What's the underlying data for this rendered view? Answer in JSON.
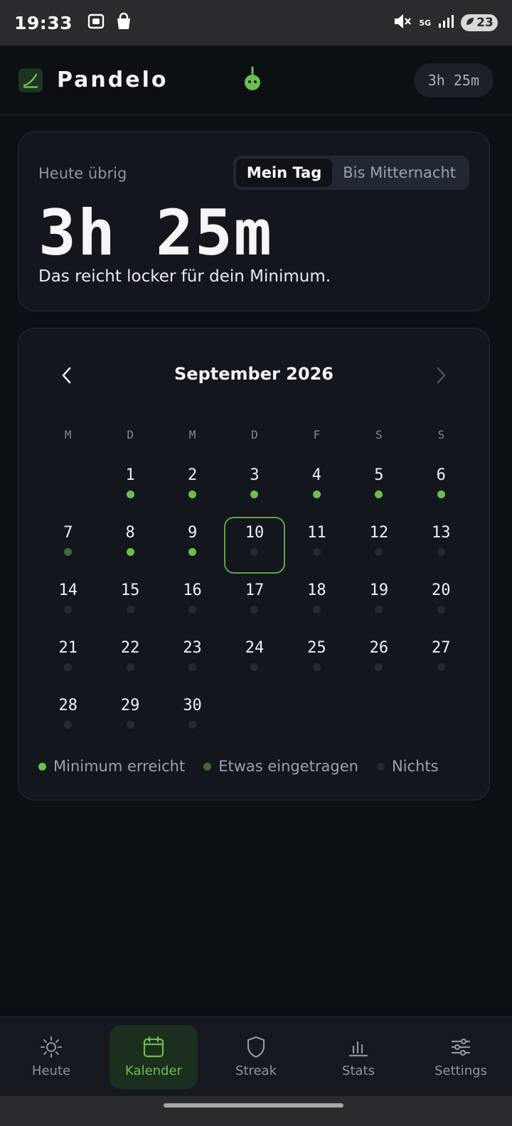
{
  "status_bar": {
    "time": "19:33",
    "network": "5G",
    "battery": "23"
  },
  "header": {
    "app_name": "Pandelo",
    "remaining_chip": "3h 25m"
  },
  "today": {
    "label": "Heute übrig",
    "toggle": {
      "option_1": "Mein Tag",
      "option_2": "Bis Mitternacht",
      "selected": "Mein Tag"
    },
    "remaining": "3h 25m",
    "message": "Das reicht locker für dein Minimum."
  },
  "calendar": {
    "month_title": "September 2026",
    "weekdays": [
      "M",
      "D",
      "M",
      "D",
      "F",
      "S",
      "S"
    ],
    "leading_blanks": 1,
    "selected_day": "10",
    "days": [
      {
        "n": "1",
        "s": "full"
      },
      {
        "n": "2",
        "s": "full"
      },
      {
        "n": "3",
        "s": "full"
      },
      {
        "n": "4",
        "s": "full"
      },
      {
        "n": "5",
        "s": "full"
      },
      {
        "n": "6",
        "s": "full"
      },
      {
        "n": "7",
        "s": "some"
      },
      {
        "n": "8",
        "s": "full"
      },
      {
        "n": "9",
        "s": "full"
      },
      {
        "n": "10",
        "s": "none"
      },
      {
        "n": "11",
        "s": "none"
      },
      {
        "n": "12",
        "s": "none"
      },
      {
        "n": "13",
        "s": "none"
      },
      {
        "n": "14",
        "s": "none"
      },
      {
        "n": "15",
        "s": "none"
      },
      {
        "n": "16",
        "s": "none"
      },
      {
        "n": "17",
        "s": "none"
      },
      {
        "n": "18",
        "s": "none"
      },
      {
        "n": "19",
        "s": "none"
      },
      {
        "n": "20",
        "s": "none"
      },
      {
        "n": "21",
        "s": "none"
      },
      {
        "n": "22",
        "s": "none"
      },
      {
        "n": "23",
        "s": "none"
      },
      {
        "n": "24",
        "s": "none"
      },
      {
        "n": "25",
        "s": "none"
      },
      {
        "n": "26",
        "s": "none"
      },
      {
        "n": "27",
        "s": "none"
      },
      {
        "n": "28",
        "s": "none"
      },
      {
        "n": "29",
        "s": "none"
      },
      {
        "n": "30",
        "s": "none"
      }
    ],
    "legend": {
      "minimum": "Minimum erreicht",
      "some": "Etwas eingetragen",
      "nothing": "Nichts"
    }
  },
  "bottom_nav": {
    "today": "Heute",
    "calendar": "Kalender",
    "streak": "Streak",
    "stats": "Stats",
    "settings": "Settings",
    "active": "Kalender"
  },
  "colors": {
    "accent": "#6cbf4f",
    "accent_dim": "#3c6a38",
    "empty_dot": "#252a31",
    "background": "#0c0f14",
    "card": "#13171d"
  }
}
